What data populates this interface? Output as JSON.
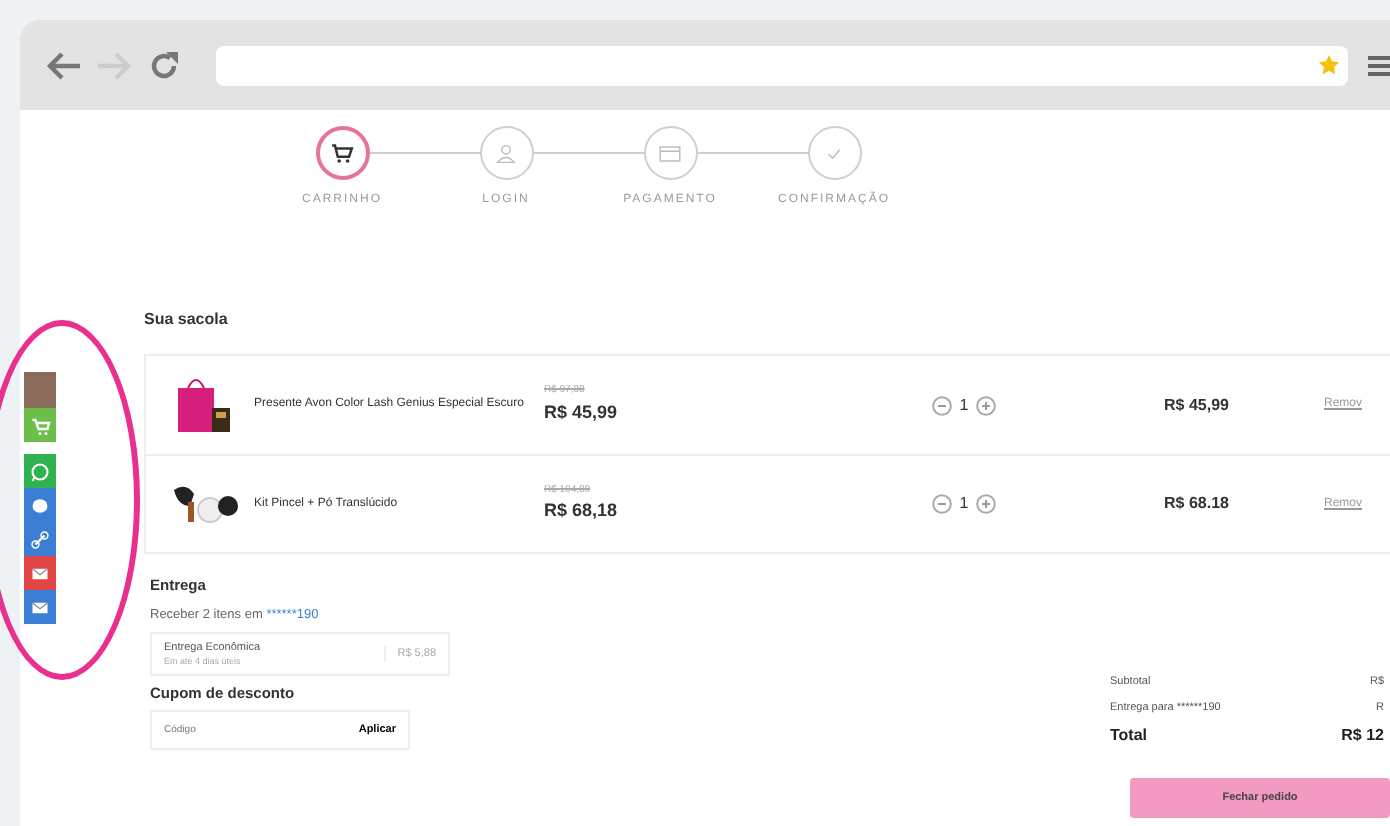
{
  "browser": {
    "forward_disabled": true,
    "bookmarked": true
  },
  "steps": [
    {
      "label": "CARRINHO",
      "kind": "cart",
      "selected": true
    },
    {
      "label": "LOGIN",
      "kind": "user",
      "selected": false
    },
    {
      "label": "PAGAMENTO",
      "kind": "card",
      "selected": false
    },
    {
      "label": "CONFIRMAÇÃO",
      "kind": "check",
      "selected": false
    }
  ],
  "share_bar": [
    {
      "kind": "avatar"
    },
    {
      "kind": "cart",
      "color": "#6cc04a"
    },
    {
      "kind": "whatsapp",
      "color": "#2fb350"
    },
    {
      "kind": "messenger",
      "color": "#3b7fd4"
    },
    {
      "kind": "link",
      "color": "#3b7fd4"
    },
    {
      "kind": "mail",
      "color": "#e04545"
    },
    {
      "kind": "mail",
      "color": "#3b7fd4"
    }
  ],
  "bag": {
    "title": "Sua sacola",
    "items": [
      {
        "kind": "bag",
        "name": "Presente Avon Color Lash Genius Especial Escuro",
        "old_price": "R$ 97,88",
        "price": "R$ 45,99",
        "quantity": "1",
        "total": "R$ 45,99",
        "remove": "Remov"
      },
      {
        "kind": "brush",
        "name": "Kit Pincel + Pó Translúcido",
        "old_price": "R$ 104,80",
        "price": "R$ 68,18",
        "quantity": "1",
        "total": "R$ 68.18",
        "remove": "Remov"
      }
    ]
  },
  "delivery": {
    "title": "Entrega",
    "summary": "Receber 2 itens em",
    "phone": "******190",
    "option": {
      "name": "Entrega Econômica",
      "eta": "Em até 4 dias úteis",
      "price": "R$ 5,88"
    }
  },
  "coupon": {
    "title": "Cupom de desconto",
    "placeholder": "Código",
    "button": "Aplicar"
  },
  "summary": {
    "rows": [
      {
        "kind": "line",
        "label": "Subtotal",
        "value": "R$"
      },
      {
        "kind": "line",
        "label": "Entrega para ******190",
        "value": "R"
      },
      {
        "kind": "total",
        "label": "Total",
        "value": "R$ 12"
      }
    ],
    "checkout": "Fechar pedido"
  }
}
